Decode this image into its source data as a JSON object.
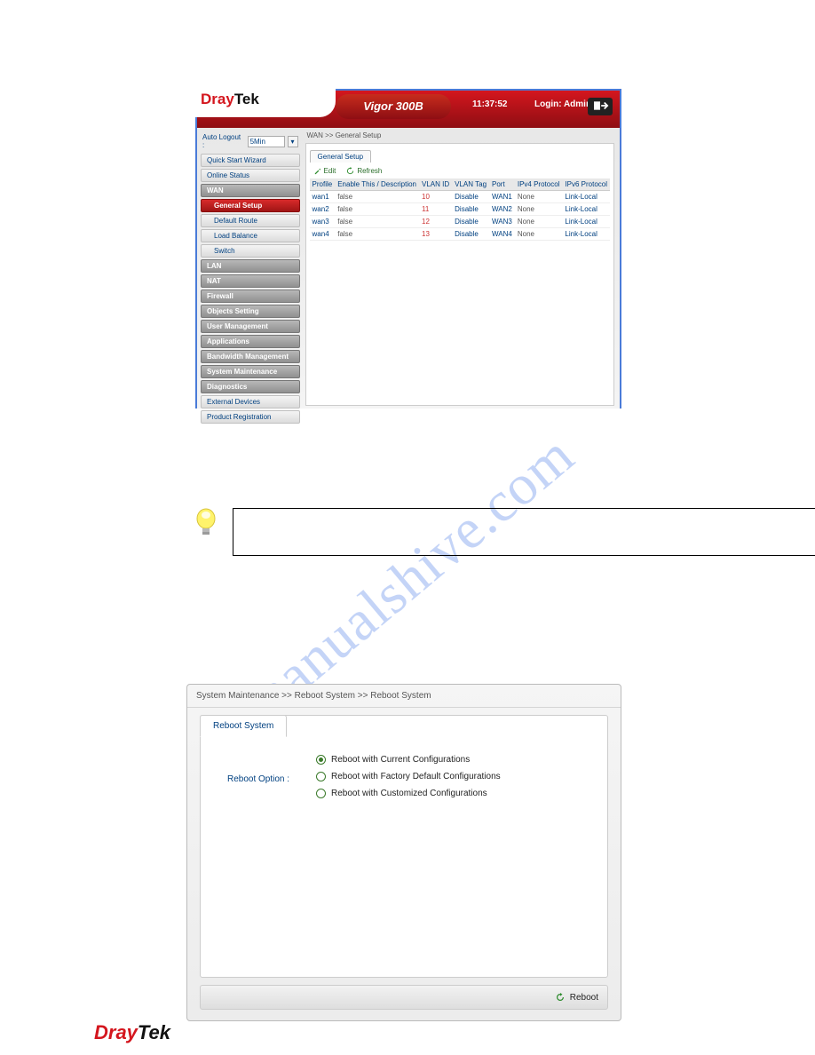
{
  "header": {
    "brand_a": "Dray",
    "brand_b": "Tek",
    "model": "Vigor 300B",
    "time": "11:37:52",
    "login": "Login: Admin"
  },
  "sidebar": {
    "auto_logout_label": "Auto Logout :",
    "auto_logout_value": "5Min",
    "items": [
      {
        "label": "Quick Start Wizard",
        "type": "item"
      },
      {
        "label": "Online Status",
        "type": "item"
      },
      {
        "label": "WAN",
        "type": "cat"
      },
      {
        "label": "General Setup",
        "type": "sub",
        "active": true
      },
      {
        "label": "Default Route",
        "type": "sub"
      },
      {
        "label": "Load Balance",
        "type": "sub"
      },
      {
        "label": "Switch",
        "type": "sub"
      },
      {
        "label": "LAN",
        "type": "cat"
      },
      {
        "label": "NAT",
        "type": "cat"
      },
      {
        "label": "Firewall",
        "type": "cat"
      },
      {
        "label": "Objects Setting",
        "type": "cat"
      },
      {
        "label": "User Management",
        "type": "cat"
      },
      {
        "label": "Applications",
        "type": "cat"
      },
      {
        "label": "Bandwidth Management",
        "type": "cat"
      },
      {
        "label": "System Maintenance",
        "type": "cat"
      },
      {
        "label": "Diagnostics",
        "type": "cat"
      },
      {
        "label": "External Devices",
        "type": "item"
      },
      {
        "label": "Product Registration",
        "type": "item"
      }
    ]
  },
  "main": {
    "breadcrumb": "WAN >> General Setup",
    "tab": "General Setup",
    "tools": {
      "edit": "Edit",
      "refresh": "Refresh"
    },
    "columns": [
      "Profile",
      "Enable This / Description",
      "VLAN ID",
      "VLAN Tag",
      "Port",
      "IPv4 Protocol",
      "IPv6 Protocol"
    ],
    "rows": [
      {
        "profile": "wan1",
        "enable": "false",
        "vlanid": "10",
        "vlantag": "Disable",
        "port": "WAN1",
        "ipv4": "None",
        "ipv6": "Link-Local"
      },
      {
        "profile": "wan2",
        "enable": "false",
        "vlanid": "11",
        "vlantag": "Disable",
        "port": "WAN2",
        "ipv4": "None",
        "ipv6": "Link-Local"
      },
      {
        "profile": "wan3",
        "enable": "false",
        "vlanid": "12",
        "vlantag": "Disable",
        "port": "WAN3",
        "ipv4": "None",
        "ipv6": "Link-Local"
      },
      {
        "profile": "wan4",
        "enable": "false",
        "vlanid": "13",
        "vlantag": "Disable",
        "port": "WAN4",
        "ipv4": "None",
        "ipv6": "Link-Local"
      }
    ]
  },
  "reboot": {
    "breadcrumb": "System Maintenance >> Reboot System >> Reboot System",
    "tab": "Reboot System",
    "label": "Reboot Option :",
    "options": [
      {
        "text": "Reboot with Current Configurations",
        "selected": true
      },
      {
        "text": "Reboot with Factory Default Configurations",
        "selected": false
      },
      {
        "text": "Reboot with Customized Configurations",
        "selected": false
      }
    ],
    "button": "Reboot"
  },
  "watermark": "manualshive.com",
  "footer": {
    "brand_a": "Dray",
    "brand_b": "Tek"
  }
}
